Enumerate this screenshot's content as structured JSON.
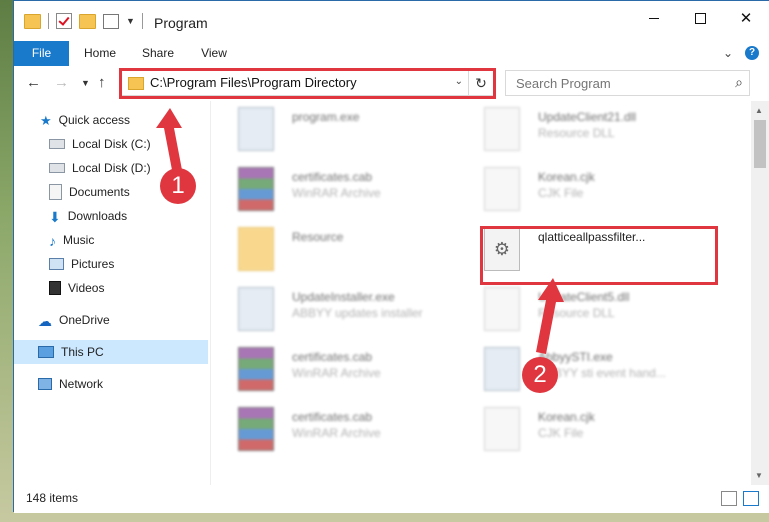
{
  "window": {
    "title": "Program"
  },
  "ribbon": {
    "tabs": [
      "File",
      "Home",
      "Share",
      "View"
    ]
  },
  "address": {
    "path": "C:\\Program Files\\Program Directory"
  },
  "search": {
    "placeholder": "Search Program"
  },
  "sidebar": {
    "items": [
      {
        "label": "Quick access",
        "icon": "star-icon"
      },
      {
        "label": "Local Disk (C:)",
        "icon": "drive-icon"
      },
      {
        "label": "Local Disk (D:)",
        "icon": "drive-icon"
      },
      {
        "label": "Documents",
        "icon": "documents-icon"
      },
      {
        "label": "Downloads",
        "icon": "download-icon"
      },
      {
        "label": "Music",
        "icon": "music-icon"
      },
      {
        "label": "Pictures",
        "icon": "pictures-icon"
      },
      {
        "label": "Videos",
        "icon": "videos-icon"
      },
      {
        "label": "OneDrive",
        "icon": "cloud-icon"
      },
      {
        "label": "This PC",
        "icon": "computer-icon"
      },
      {
        "label": "Network",
        "icon": "network-icon"
      }
    ]
  },
  "files": [
    {
      "name": "program.exe",
      "type": ""
    },
    {
      "name": "UpdateClient21.dll",
      "type": "Resource DLL"
    },
    {
      "name": "certificates.cab",
      "type": "WinRAR Archive"
    },
    {
      "name": "Korean.cjk",
      "type": "CJK File"
    },
    {
      "name": "Resource",
      "type": ""
    },
    {
      "name": "qlatticeallpassfilter...",
      "type": ""
    },
    {
      "name": "UpdateInstaller.exe",
      "type": "ABBYY updates installer"
    },
    {
      "name": "UpdateClient5.dll",
      "type": "Resource DLL"
    },
    {
      "name": "certificates.cab",
      "type": "WinRAR Archive"
    },
    {
      "name": "AbbyySTI.exe",
      "type": "ABBYY sti event hand..."
    },
    {
      "name": "certificates.cab",
      "type": "WinRAR Archive"
    },
    {
      "name": "Korean.cjk",
      "type": "CJK File"
    }
  ],
  "status": {
    "count": "148 items"
  },
  "annotations": [
    "1",
    "2"
  ],
  "colors": {
    "accent": "#1979ca",
    "highlight": "#e0363f"
  }
}
